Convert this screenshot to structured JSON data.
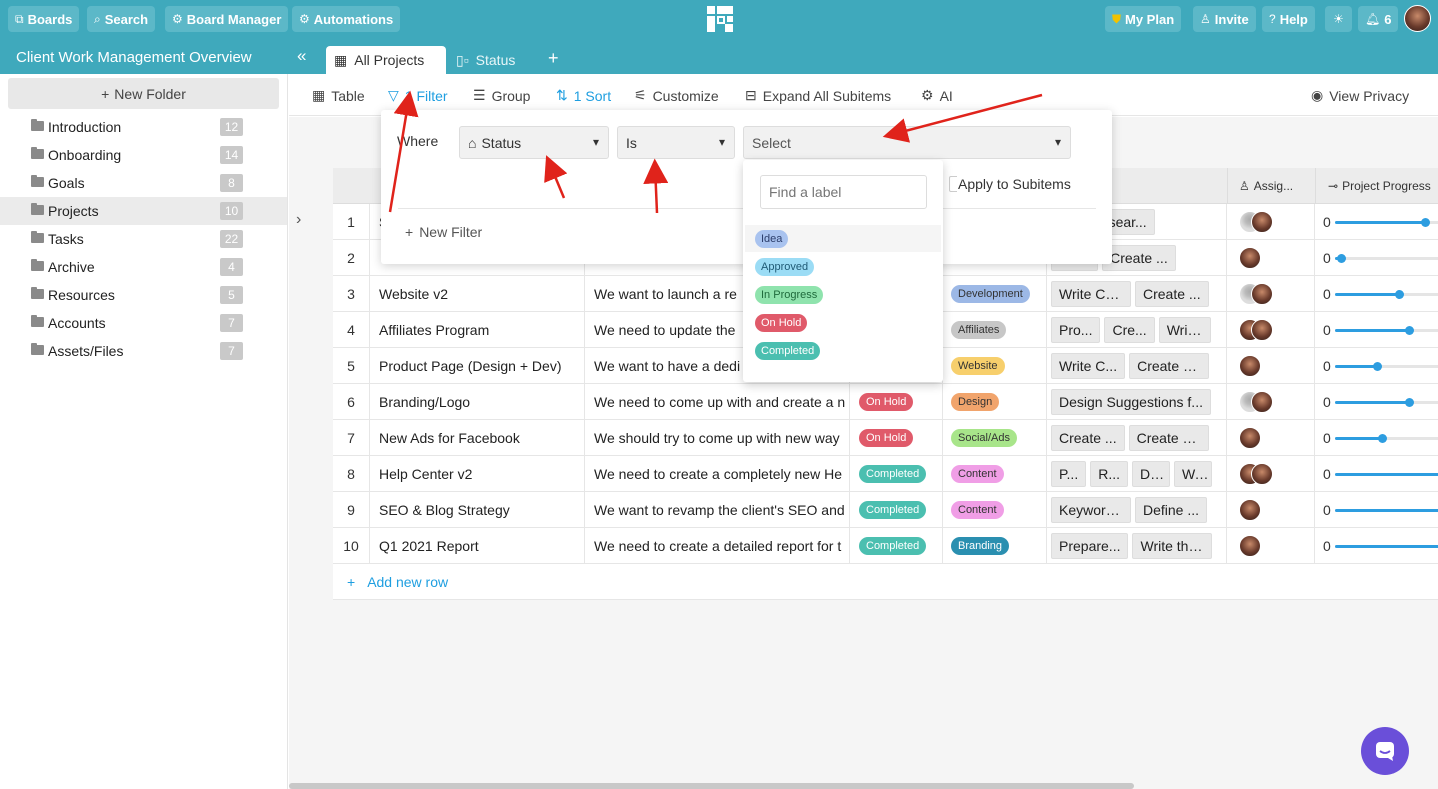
{
  "topnav": {
    "boards": "Boards",
    "search": "Search",
    "board_manager": "Board Manager",
    "automations": "Automations",
    "my_plan": "My Plan",
    "invite": "Invite",
    "help": "Help",
    "notifications_count": "6"
  },
  "board": {
    "title": "Client Work Management Overview",
    "views": [
      "All Projects",
      "Status"
    ]
  },
  "sidebar": {
    "new_folder": "New Folder",
    "folders": [
      {
        "label": "Introduction",
        "count": "12"
      },
      {
        "label": "Onboarding",
        "count": "14"
      },
      {
        "label": "Goals",
        "count": "8"
      },
      {
        "label": "Projects",
        "count": "10"
      },
      {
        "label": "Tasks",
        "count": "22"
      },
      {
        "label": "Archive",
        "count": "4"
      },
      {
        "label": "Resources",
        "count": "5"
      },
      {
        "label": "Accounts",
        "count": "7"
      },
      {
        "label": "Assets/Files",
        "count": "7"
      }
    ]
  },
  "toolbar": {
    "table": "Table",
    "filter": "1 Filter",
    "group": "Group",
    "sort": "1 Sort",
    "customize": "Customize",
    "expand": "Expand All Subitems",
    "ai": "AI",
    "privacy": "View Privacy"
  },
  "filter": {
    "where": "Where",
    "field": "Status",
    "operator": "Is",
    "value_placeholder": "Select",
    "apply_subitems": "Apply to Subitems",
    "new_filter": "New Filter",
    "find_placeholder": "Find a label",
    "labels": [
      {
        "text": "Idea",
        "bg": "#a9c3ef",
        "fg": "#2c3e6b"
      },
      {
        "text": "Approved",
        "bg": "#9bdcf5",
        "fg": "#1f5a75"
      },
      {
        "text": "In Progress",
        "bg": "#8fe3ad",
        "fg": "#1f6b3c"
      },
      {
        "text": "On Hold",
        "bg": "#e05a6a",
        "fg": "#ffffff"
      },
      {
        "text": "Completed",
        "bg": "#4bbfb0",
        "fg": "#ffffff"
      }
    ]
  },
  "table": {
    "headers": {
      "assignee": "Assig...",
      "progress": "Project Progress"
    },
    "rows": [
      {
        "num": "1",
        "name": "S",
        "desc": "",
        "status": "",
        "tag": "",
        "subitems": [
          "...",
          "Resear..."
        ],
        "progress_label": "0",
        "progress": 0.82
      },
      {
        "num": "2",
        "name": "",
        "desc": "",
        "status": "",
        "tag": "",
        "subitems": [
          "...n...",
          "Create ..."
        ],
        "progress_label": "0",
        "progress": 0.05
      },
      {
        "num": "3",
        "name": "Website v2",
        "desc": "We want to launch a re",
        "status": "",
        "tag": "Development",
        "tag_color": "#9cb8e6",
        "subitems": [
          "Write Con...",
          "Create ..."
        ],
        "progress_label": "0",
        "progress": 0.58
      },
      {
        "num": "4",
        "name": "Affiliates Program",
        "desc": "We need to update the",
        "status": "",
        "tag": "Affiliates",
        "tag_color": "#c7c7c7",
        "subitems": [
          "Pro...",
          "Cre...",
          "Writ..."
        ],
        "progress_label": "0",
        "progress": 0.67
      },
      {
        "num": "5",
        "name": "Product Page (Design + Dev)",
        "desc": "We want to have a dedi",
        "status": "",
        "tag": "Website",
        "tag_color": "#f7cf6c",
        "subitems": [
          "Write C...",
          "Create a ..."
        ],
        "progress_label": "0",
        "progress": 0.38
      },
      {
        "num": "6",
        "name": "Branding/Logo",
        "desc": "We need to come up with and create a n",
        "status": "On Hold",
        "status_color": "#e05a6a",
        "tag": "Design",
        "tag_color": "#f1a46c",
        "subitems": [
          "Design Suggestions f..."
        ],
        "progress_label": "0",
        "progress": 0.67
      },
      {
        "num": "7",
        "name": "New Ads for Facebook",
        "desc": "We should try to come up with new way",
        "status": "On Hold",
        "status_color": "#e05a6a",
        "tag": "Social/Ads",
        "tag_color": "#a8e58a",
        "subitems": [
          "Create ...",
          "Create N..."
        ],
        "progress_label": "0",
        "progress": 0.43
      },
      {
        "num": "8",
        "name": "Help Center v2",
        "desc": "We need to create a completely new He",
        "status": "Completed",
        "status_color": "#4bbfb0",
        "tag": "Content",
        "tag_color": "#f09ee6",
        "subitems": [
          "P...",
          "R...",
          "De...",
          "W..."
        ],
        "progress_label": "0",
        "progress": 1.0
      },
      {
        "num": "9",
        "name": "SEO & Blog Strategy",
        "desc": "We want to revamp the client's SEO and",
        "status": "Completed",
        "status_color": "#4bbfb0",
        "tag": "Content",
        "tag_color": "#f09ee6",
        "subitems": [
          "Keyword ...",
          "Define ..."
        ],
        "progress_label": "0",
        "progress": 1.0
      },
      {
        "num": "10",
        "name": "Q1 2021 Report",
        "desc": "We need to create a detailed report for t",
        "status": "Completed",
        "status_color": "#4bbfb0",
        "tag": "Branding",
        "tag_color": "#2a8fb0",
        "subitems": [
          "Prepare...",
          "Write the..."
        ],
        "progress_label": "0",
        "progress": 1.0
      }
    ],
    "add_row": "Add new row"
  }
}
